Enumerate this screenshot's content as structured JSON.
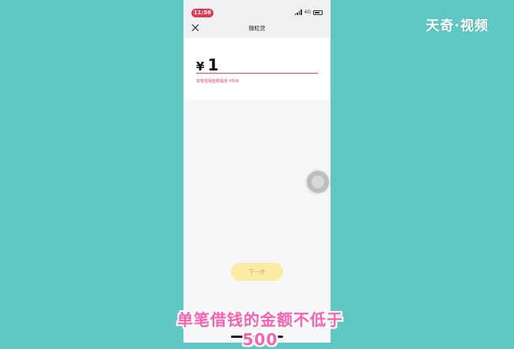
{
  "watermark": "天奇·视频",
  "status": {
    "time": "11:56",
    "network": "4G"
  },
  "nav": {
    "title": "微粒贷",
    "close_icon": "close-icon"
  },
  "loan": {
    "currency": "¥",
    "amount": "1",
    "hint": "单笔借钱金额最低 ¥500"
  },
  "footer": {
    "next_label": "下一步"
  },
  "subtitle": "单笔借钱的金额不低于500",
  "colors": {
    "background": "#5fc8c3",
    "accent": "#e64b6a",
    "button": "#fbeca4",
    "subtitle": "#ff5fb0"
  }
}
